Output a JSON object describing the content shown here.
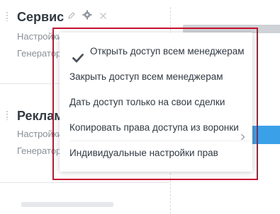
{
  "pipelines": [
    {
      "title": "Сервис",
      "lines": [
        "Настройки",
        "Генератор"
      ]
    },
    {
      "title": "Реклама",
      "lines": [
        "Настройки",
        "Генератор"
      ]
    }
  ],
  "menu": {
    "items": [
      {
        "label": "Открыть доступ всем менеджерам",
        "checked": true,
        "submenu": false
      },
      {
        "label": "Закрыть доступ всем менеджерам",
        "checked": false,
        "submenu": false
      },
      {
        "label": "Дать доступ только на свои сделки",
        "checked": false,
        "submenu": false
      },
      {
        "label": "Копировать права доступа из воронки",
        "checked": false,
        "submenu": true
      },
      {
        "label": "Индивидуальные настройки прав",
        "checked": false,
        "submenu": false
      }
    ]
  },
  "colors": {
    "highlight": "#c8102e",
    "accent": "#3aa0e8",
    "text": "#313942",
    "muted": "#8a8f96"
  }
}
